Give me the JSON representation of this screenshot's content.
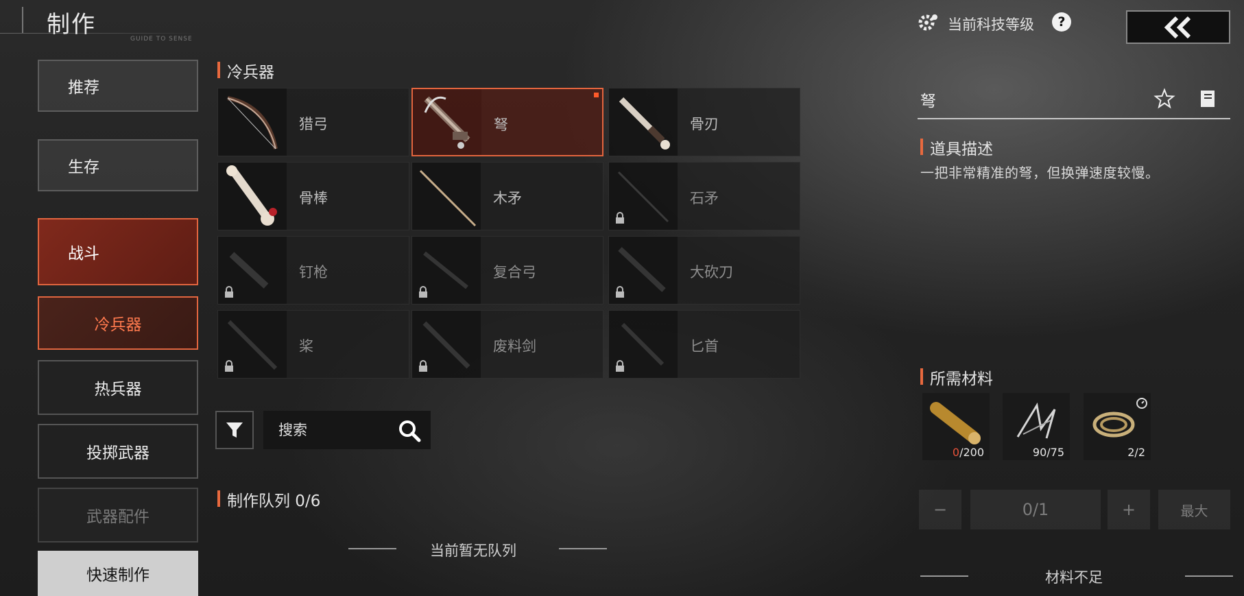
{
  "header": {
    "title": "制作",
    "subtitle": "GUIDE TO SENSE"
  },
  "sidebar": {
    "items": [
      {
        "label": "推荐"
      },
      {
        "label": "生存"
      },
      {
        "label": "战斗"
      },
      {
        "label": "冷兵器"
      },
      {
        "label": "热兵器"
      },
      {
        "label": "投掷武器"
      },
      {
        "label": "武器配件"
      },
      {
        "label": "快速制作"
      }
    ]
  },
  "category": {
    "label": "冷兵器"
  },
  "grid": {
    "items": [
      {
        "name": "猎弓",
        "icon": "hunting-bow-icon",
        "locked": false
      },
      {
        "name": "弩",
        "icon": "crossbow-icon",
        "locked": false,
        "selected": true
      },
      {
        "name": "骨刃",
        "icon": "bone-blade-icon",
        "locked": false
      },
      {
        "name": "骨棒",
        "icon": "bone-club-icon",
        "locked": false
      },
      {
        "name": "木矛",
        "icon": "wooden-spear-icon",
        "locked": false
      },
      {
        "name": "石矛",
        "icon": "stone-spear-icon",
        "locked": true
      },
      {
        "name": "钉枪",
        "icon": "nail-gun-icon",
        "locked": true
      },
      {
        "name": "复合弓",
        "icon": "compound-bow-icon",
        "locked": true
      },
      {
        "name": "大砍刀",
        "icon": "machete-icon",
        "locked": true
      },
      {
        "name": "桨",
        "icon": "paddle-icon",
        "locked": true
      },
      {
        "name": "废料剑",
        "icon": "scrap-sword-icon",
        "locked": true
      },
      {
        "name": "匕首",
        "icon": "dagger-icon",
        "locked": true
      }
    ]
  },
  "search": {
    "placeholder": "搜索"
  },
  "queue": {
    "label": "制作队列 0/6",
    "empty_text": "当前暂无队列"
  },
  "right": {
    "tech_label": "当前科技等级",
    "help": "?",
    "item_title": "弩",
    "desc_header": "道具描述",
    "description": "一把非常精准的弩，但换弹速度较慢。",
    "materials_header": "所需材料",
    "materials": [
      {
        "icon": "wood-log-icon",
        "have": "0",
        "need": "/200"
      },
      {
        "icon": "metal-scrap-icon",
        "have": "90",
        "need": "/75"
      },
      {
        "icon": "rope-coil-icon",
        "have": "2",
        "need": "/2"
      }
    ],
    "quantity": {
      "minus": "−",
      "value": "0/1",
      "plus": "+",
      "max": "最大"
    },
    "status": "材料不足"
  },
  "colors": {
    "accent": "#e8693e",
    "lack": "#e9523a"
  }
}
